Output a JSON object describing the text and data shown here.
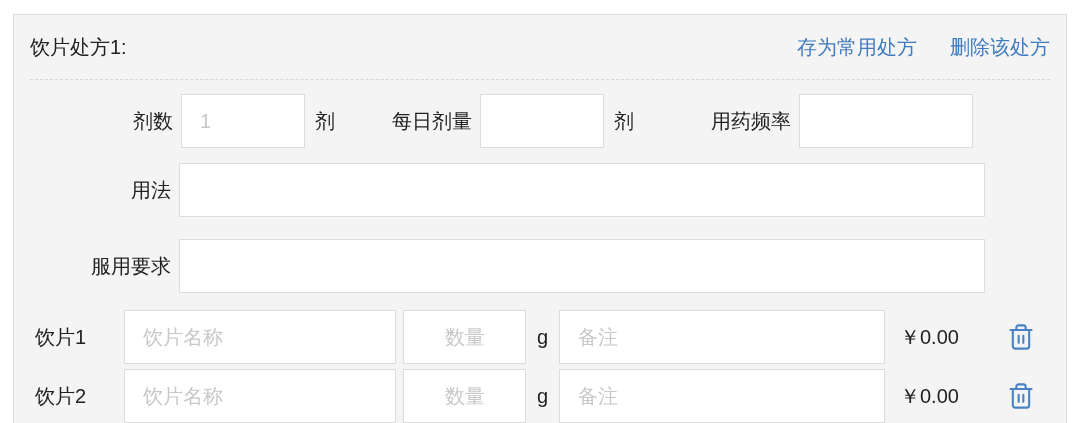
{
  "prescription": {
    "title": "饮片处方1:",
    "actions": [
      "存为常用处方",
      "删除该处方"
    ]
  },
  "dose_row": [
    {
      "label": "剂数",
      "placeholder": "1",
      "unit": "剂"
    },
    {
      "label": "每日剂量",
      "unit": "剂"
    },
    {
      "label": "用药频率"
    }
  ],
  "fields": [
    {
      "label": "用法"
    },
    {
      "label": "服用要求"
    }
  ],
  "herbs": [
    {
      "label": "饮片1",
      "name_placeholder": "饮片名称",
      "quantity_placeholder": "数量",
      "unit": "g",
      "note_placeholder": "备注",
      "price": "￥0.00"
    },
    {
      "label": "饮片2",
      "name_placeholder": "饮片名称",
      "quantity_placeholder": "数量",
      "unit": "g",
      "note_placeholder": "备注",
      "price": "￥0.00"
    }
  ]
}
